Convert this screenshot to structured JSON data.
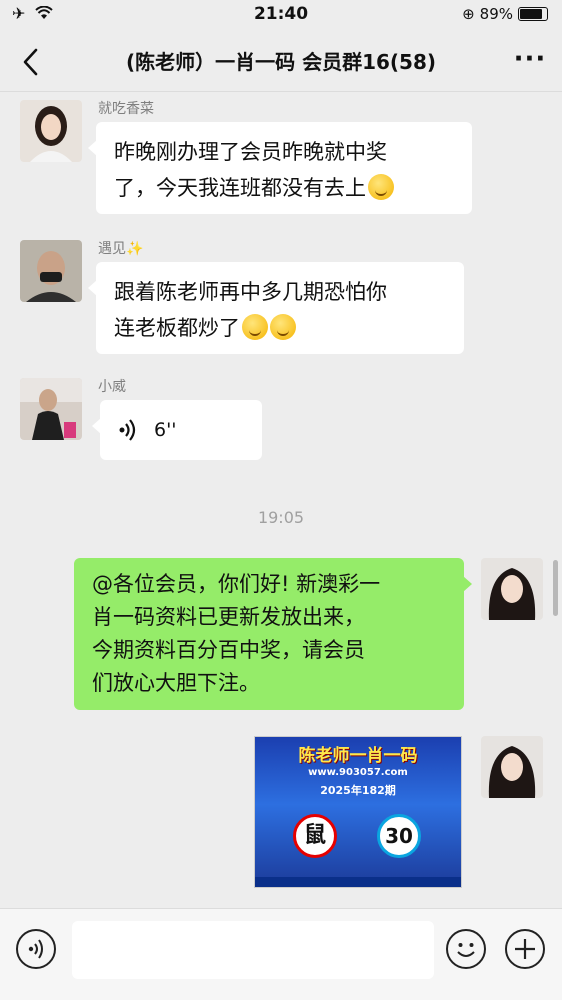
{
  "status_bar": {
    "time": "21:40",
    "battery": "89%",
    "battery_level": 0.89
  },
  "header": {
    "title": "(陈老师）一肖一码 会员群16(58)",
    "back_icon": "chevron-left-icon",
    "more_label": "···"
  },
  "messages": [
    {
      "sender": "就吃香菜",
      "lines": [
        "昨晚刚办理了会员昨晚就中奖",
        "了，今天我连班都没有去上"
      ],
      "emoji": "laughing-tears"
    },
    {
      "sender": "遇见✨",
      "lines": [
        "跟着陈老师再中多几期恐怕你",
        "连老板都炒了"
      ],
      "emoji": "thinking"
    },
    {
      "sender": "小威",
      "voice_duration": "6''"
    }
  ],
  "time_divider": "19:05",
  "my_messages": {
    "lines": [
      "@各位会员，你们好! 新澳彩一",
      "肖一码资料已更新发放出来，",
      "今期资料百分百中奖，请会员",
      "们放心大胆下注。"
    ],
    "image": {
      "title": "陈老师一肖一码",
      "url": "www.903057.com",
      "period": "2025年182期",
      "zodiac": "鼠",
      "number": "30"
    }
  },
  "input_bar": {
    "voice_icon": "voice-icon",
    "emoji_icon": "emoji-icon",
    "plus_icon": "plus-icon"
  },
  "colors": {
    "background": "#ededed",
    "outgoing_bubble": "#95ec69",
    "incoming_bubble": "#ffffff"
  }
}
